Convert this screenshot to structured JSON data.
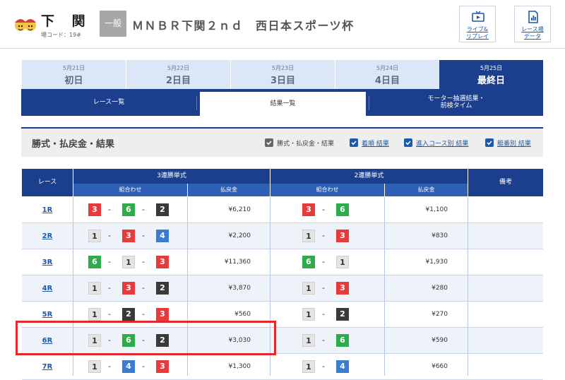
{
  "header": {
    "venue": "下 関",
    "venue_code": "場コード：19#",
    "grade": "一般",
    "race_title": "ＭＮＢＲ下関２ｎｄ　西日本スポーツ杯",
    "buttons": [
      {
        "icon": "tv-icon",
        "line1": "ライブ&",
        "line2": "リプレイ"
      },
      {
        "icon": "data-chart-icon",
        "line1": "レース場",
        "line2": "データ"
      }
    ]
  },
  "day_tabs": [
    {
      "date": "5月21日",
      "name": "初日",
      "active": false
    },
    {
      "date": "5月22日",
      "name": "2日目",
      "active": false
    },
    {
      "date": "5月23日",
      "name": "3日目",
      "active": false
    },
    {
      "date": "5月24日",
      "name": "4日目",
      "active": false
    },
    {
      "date": "5月25日",
      "name": "最終日",
      "active": true
    }
  ],
  "sub_tabs": [
    {
      "label": "レース一覧",
      "active": false
    },
    {
      "label": "結果一覧",
      "active": true
    },
    {
      "label_line1": "モーター抽選結果・",
      "label_line2": "前検タイム",
      "active": false
    }
  ],
  "section": {
    "title": "勝式・払戻金・結果",
    "filters": [
      {
        "label": "勝式・払戻金・結果",
        "checked": true,
        "style": "gray"
      },
      {
        "label": "着順 結果",
        "checked": true,
        "style": "blue"
      },
      {
        "label": "進入コース別 結果",
        "checked": true,
        "style": "blue"
      },
      {
        "label": "艇番別 結果",
        "checked": true,
        "style": "blue"
      }
    ]
  },
  "table": {
    "race_header": "レース",
    "trifecta_header": "3連勝単式",
    "exacta_header": "2連勝単式",
    "note_header": "備考",
    "combo_header": "組合わせ",
    "payout_header": "払戻金",
    "rows": [
      {
        "race": "1R",
        "tri": [
          "3",
          "6",
          "2"
        ],
        "tri_pay": "¥6,210",
        "ex": [
          "3",
          "6"
        ],
        "ex_pay": "¥1,100"
      },
      {
        "race": "2R",
        "tri": [
          "1",
          "3",
          "4"
        ],
        "tri_pay": "¥2,200",
        "ex": [
          "1",
          "3"
        ],
        "ex_pay": "¥830"
      },
      {
        "race": "3R",
        "tri": [
          "6",
          "1",
          "3"
        ],
        "tri_pay": "¥11,360",
        "ex": [
          "6",
          "1"
        ],
        "ex_pay": "¥1,930"
      },
      {
        "race": "4R",
        "tri": [
          "1",
          "3",
          "2"
        ],
        "tri_pay": "¥3,870",
        "ex": [
          "1",
          "3"
        ],
        "ex_pay": "¥280"
      },
      {
        "race": "5R",
        "tri": [
          "1",
          "2",
          "3"
        ],
        "tri_pay": "¥560",
        "ex": [
          "1",
          "2"
        ],
        "ex_pay": "¥270"
      },
      {
        "race": "6R",
        "tri": [
          "1",
          "6",
          "2"
        ],
        "tri_pay": "¥3,030",
        "ex": [
          "1",
          "6"
        ],
        "ex_pay": "¥590"
      },
      {
        "race": "7R",
        "tri": [
          "1",
          "4",
          "3"
        ],
        "tri_pay": "¥1,300",
        "ex": [
          "1",
          "4"
        ],
        "ex_pay": "¥660"
      }
    ]
  },
  "colors": {
    "primary": "#1b3f8c",
    "highlight": "#e0282d",
    "boat1": "#e4e4e4",
    "boat2": "#3a3a3a",
    "boat3": "#e73a3a",
    "boat4": "#3a7cd0",
    "boat5": "#f3d93a",
    "boat6": "#2eab4a"
  },
  "highlighted_row": "6R"
}
